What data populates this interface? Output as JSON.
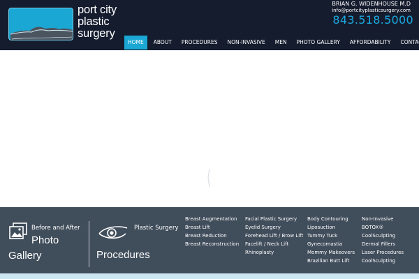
{
  "brand": {
    "logo_lines": [
      "port city",
      "plastic",
      "surgery"
    ],
    "logo_color": "#1aa7d4"
  },
  "contact": {
    "doctor": "BRIAN G. WIDENHOUSE M.D",
    "email": "info@portcityplasticsurgery.com",
    "phone": "843.518.5000",
    "phone_color": "#1ba9e0"
  },
  "nav": {
    "items": [
      {
        "label": "HOME",
        "active": true
      },
      {
        "label": "ABOUT",
        "active": false
      },
      {
        "label": "PROCEDURES",
        "active": false
      },
      {
        "label": "NON-INVASIVE",
        "active": false
      },
      {
        "label": "MEN",
        "active": false
      },
      {
        "label": "PHOTO GALLERY",
        "active": false
      },
      {
        "label": "AFFORDABILITY",
        "active": false
      },
      {
        "label": "CONTACT",
        "active": false
      }
    ],
    "active_color": "#1aa7d4",
    "background": "#151c2e"
  },
  "footer": {
    "gallery": {
      "top_text": "Before and After",
      "line1": "Photo",
      "line2": "Gallery",
      "icon": "photos-icon"
    },
    "procedures": {
      "top_text": "Plastic Surgery",
      "title": "Procedures",
      "icon": "eye-icon"
    },
    "columns": [
      [
        "Breast Augmentation",
        "Breast Lift",
        "Breast Reduction",
        "Breast Reconstruction"
      ],
      [
        "Facial Plastic Surgery",
        "Eyelid Surgery",
        "Forehead Lift / Brow Lift",
        "Facelift / Neck Lift",
        "Rhinoplasty"
      ],
      [
        "Body Contouring",
        "Liposuction",
        "Tummy Tuck",
        "Gynecomastia",
        "Mommy Makeovers",
        "Brazilian Butt Lift"
      ],
      [
        "Non-Invasive",
        "BOTOX®",
        "CoolSculpting",
        "Dermal Fillers",
        "Laser Procedures",
        "CoolSculpting"
      ]
    ],
    "background": "#404d5b"
  }
}
